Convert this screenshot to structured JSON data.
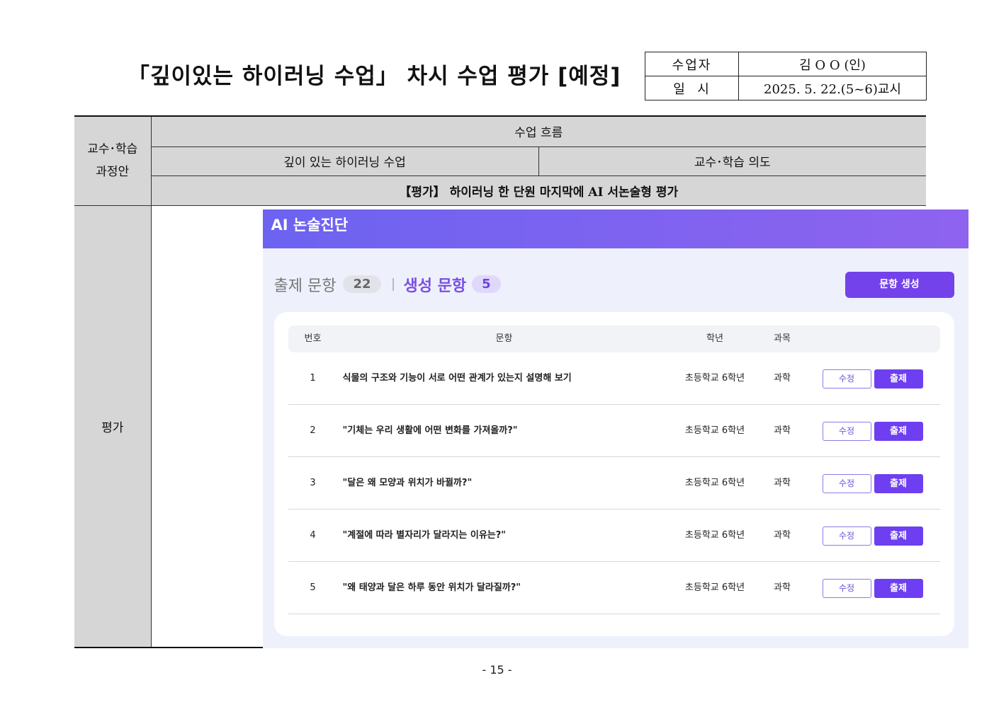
{
  "document": {
    "title": "「깊이있는 하이러닝 수업」 차시 수업 평가 [예정]",
    "info": [
      {
        "label": "수업자",
        "value": "김 O O (인)"
      },
      {
        "label": "일  시",
        "value": "2025. 5. 22.(5~6)교시"
      }
    ],
    "page_number": "- 15 -"
  },
  "table": {
    "side_label_1": "교수･학습\n과정안",
    "flow_header": "수업 흐름",
    "col_left": "깊이 있는 하이러닝 수업",
    "col_right": "교수･학습 의도",
    "eval_bracket": "【평가】",
    "eval_text": " 하이러닝 한 단원 마지막에 AI 서논술형 평가",
    "side_label_2": "평가"
  },
  "ai_app": {
    "title": "AI 논술진단",
    "total_label": "출제 문항",
    "total_count": "22",
    "generated_label": "생성 문항",
    "generated_count": "5",
    "generate_button": "문항 생성",
    "columns": {
      "num": "번호",
      "question": "문항",
      "grade": "학년",
      "subject": "과목"
    },
    "edit_label": "수정",
    "publish_label": "출제",
    "rows": [
      {
        "num": "1",
        "question": "식물의 구조와 기능이 서로 어떤 관계가 있는지 설명해 보기",
        "grade": "초등학교 6학년",
        "subject": "과학"
      },
      {
        "num": "2",
        "question": "\"기체는 우리 생활에 어떤 변화를 가져올까?\"",
        "grade": "초등학교 6학년",
        "subject": "과학"
      },
      {
        "num": "3",
        "question": "\"달은 왜 모양과 위치가 바뀔까?\"",
        "grade": "초등학교 6학년",
        "subject": "과학"
      },
      {
        "num": "4",
        "question": "\"계절에 따라 별자리가 달라지는 이유는?\"",
        "grade": "초등학교 6학년",
        "subject": "과학"
      },
      {
        "num": "5",
        "question": "\"왜 태양과 달은 하루 동안 위치가 달라질까?\"",
        "grade": "초등학교 6학년",
        "subject": "과학"
      }
    ]
  }
}
